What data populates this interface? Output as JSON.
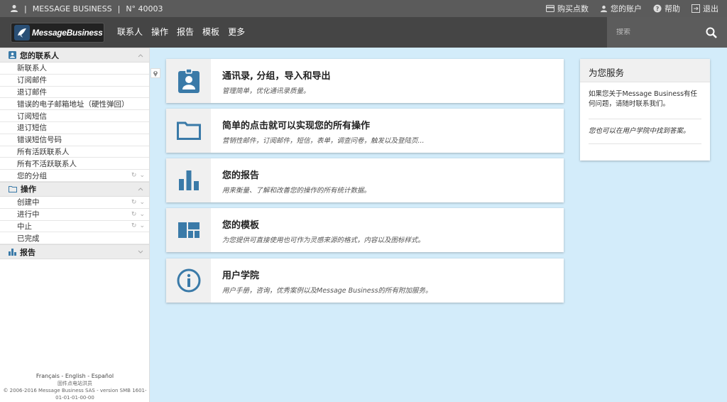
{
  "topbar": {
    "company": "MESSAGE BUSINESS",
    "account_no": "N° 40003",
    "buy_points": "购买点数",
    "my_account": "您的账户",
    "help": "帮助",
    "logout": "退出"
  },
  "nav": {
    "logo_text": "MessageBusiness",
    "items": [
      "联系人",
      "操作",
      "报告",
      "模板",
      "更多"
    ],
    "search_placeholder": "搜索"
  },
  "sidebar": {
    "contacts": {
      "title": "您的联系人",
      "items": [
        "新联系人",
        "订阅邮件",
        "退订邮件",
        "错误的电子邮箱地址（硬性弹回）",
        "订阅短信",
        "退订短信",
        "错误短信号码",
        "所有活跃联系人",
        "所有不活跃联系人",
        "您的分组"
      ]
    },
    "operations": {
      "title": "操作",
      "items": [
        "创建中",
        "进行中",
        "中止",
        "已完成"
      ]
    },
    "reports": {
      "title": "报告"
    },
    "footer_langs": "Français - English - Español",
    "footer_sub": "固件点电站洪员",
    "footer_copy": "© 2006-2016 Message Business SAS - version SMB 1601-01-01-01-00-00"
  },
  "cards": [
    {
      "title": "通讯录, 分组，导入和导出",
      "desc": "管理简单，优化通讯录质量。",
      "icon": "contact-badge-icon"
    },
    {
      "title": "简单的点击就可以实现您的所有操作",
      "desc": "营销性邮件，订阅邮件，短信，表单，调查问卷，触发以及登陆页...",
      "icon": "folder-icon"
    },
    {
      "title": "您的报告",
      "desc": "用来衡量、了解和改善您的操作的所有统计数据。",
      "icon": "bar-chart-icon"
    },
    {
      "title": "您的模板",
      "desc": "为您提供可直接使用也可作为灵感来源的格式，内容以及图标样式。",
      "icon": "template-grid-icon"
    },
    {
      "title": "用户学院",
      "desc": "用户手册，咨询，优秀案例以及Message Business的所有附加服务。",
      "icon": "info-icon"
    }
  ],
  "service": {
    "title": "为您服务",
    "text1": "如果您关于Message Business有任何问题，请随时联系我们。",
    "text2": "您也可以在用户学院中找到答案。"
  },
  "colors": {
    "accent": "#3a7aa8",
    "topbar": "#5b5b5b",
    "navbar": "#454545",
    "background": "#d3ecfa"
  }
}
